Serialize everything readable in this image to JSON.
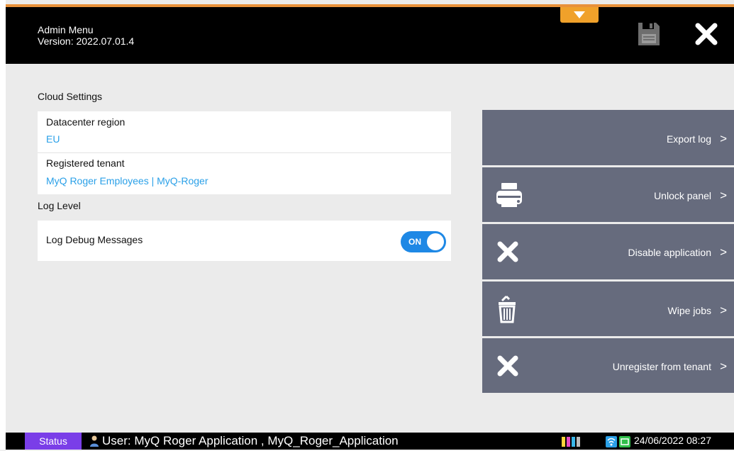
{
  "header": {
    "title": "Admin Menu",
    "version": "Version: 2022.07.01.4",
    "pulldown_icon": "triangle-down-icon",
    "save_icon": "floppy-disk-icon",
    "close_icon": "close-icon"
  },
  "cloud_settings": {
    "heading": "Cloud Settings",
    "datacenter_label": "Datacenter region",
    "datacenter_value": "EU",
    "tenant_label": "Registered tenant",
    "tenant_value": "MyQ Roger Employees | MyQ-Roger"
  },
  "log_level": {
    "heading": "Log Level",
    "debug_label": "Log Debug Messages",
    "toggle_text": "ON",
    "toggle_on": true
  },
  "actions": [
    {
      "label": "Export log",
      "icon": ""
    },
    {
      "label": "Unlock panel",
      "icon": "printer-icon"
    },
    {
      "label": "Disable application",
      "icon": "close-icon"
    },
    {
      "label": "Wipe jobs",
      "icon": "trash-icon"
    },
    {
      "label": "Unregister from tenant",
      "icon": "close-icon"
    }
  ],
  "status_bar": {
    "tab": "Status",
    "user": "User: MyQ Roger Application , MyQ_Roger_Application",
    "datetime": "24/06/2022  08:27"
  },
  "colors": {
    "accent_orange": "#e8913a",
    "link_blue": "#2aa0e8",
    "action_panel": "#666b7d",
    "status_purple": "#7a3ee8"
  }
}
